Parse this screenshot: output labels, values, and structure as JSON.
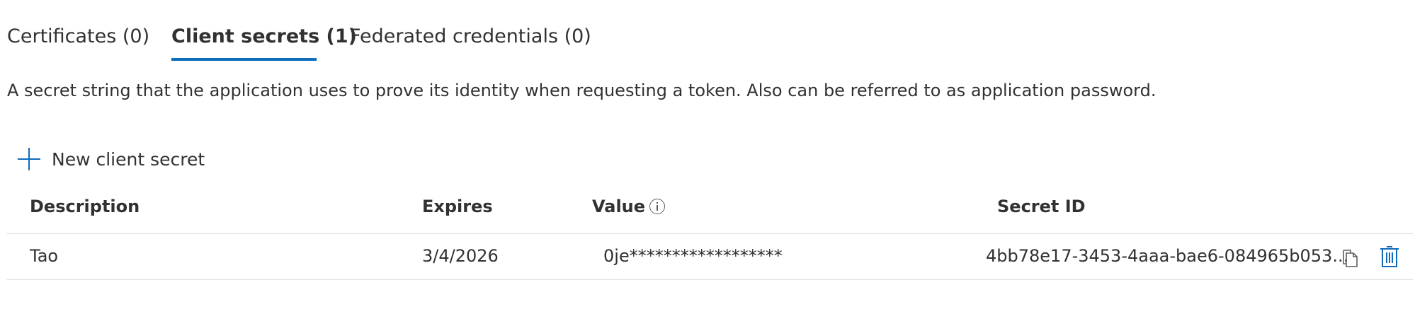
{
  "tabs": [
    {
      "label": "Certificates (0)",
      "selected": false
    },
    {
      "label": "Client secrets (1)",
      "selected": true
    },
    {
      "label": "Federated credentials (0)",
      "selected": false
    }
  ],
  "description": "A secret string that the application uses to prove its identity when requesting a token. Also can be referred to as application password.",
  "toolbar": {
    "new_secret_label": "New client secret",
    "new_secret_icon": "plus-icon"
  },
  "table": {
    "columns": [
      "Description",
      "Expires",
      "Value",
      "Secret ID"
    ],
    "rows": [
      {
        "description": "Tao",
        "expires": "3/4/2026",
        "value": "0je******************",
        "secret_id": "4bb78e17-3453-4aaa-bae6-084965b053..."
      }
    ]
  },
  "colors": {
    "accent": "#0f6cbd",
    "text": "#323130",
    "divider": "#e1dfdd"
  }
}
